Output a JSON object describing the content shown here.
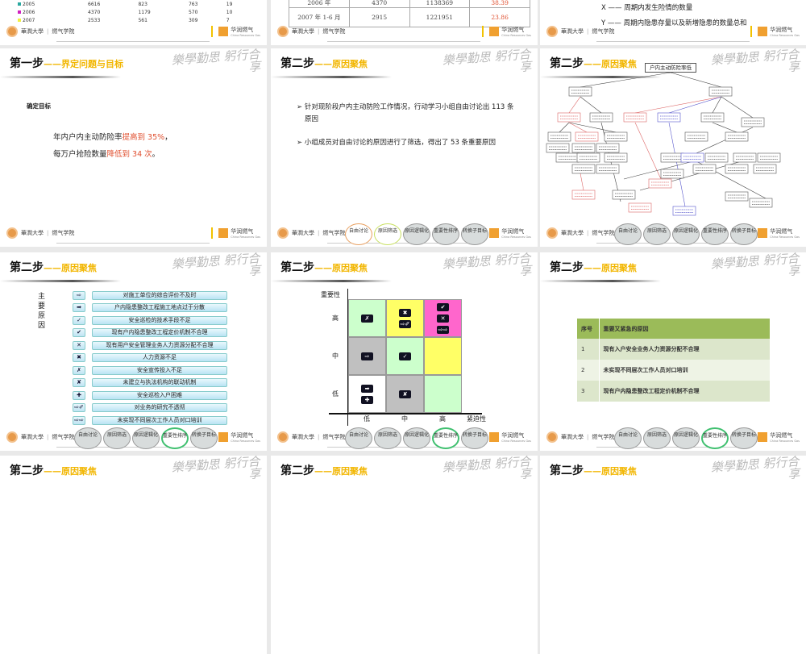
{
  "common": {
    "step1_title": "第一步",
    "step1_sub": "——界定问题与目标",
    "step2_title": "第二步",
    "step2_sub": "——原因聚焦",
    "calligraphy": "樂學勤思 躬行合享",
    "univ": "華潤大學",
    "college": "燃气学院",
    "brand": "华润燃气",
    "brand_en": "China Resources Gas",
    "steps": [
      "自由讨论",
      "原因筛选",
      "原因逻辑化",
      "重要性排序",
      "转换子目标"
    ]
  },
  "slide_a": {
    "legend": [
      {
        "year": "2005",
        "color": "#2aa8a0",
        "v": [
          "6616",
          "823",
          "763",
          "19"
        ]
      },
      {
        "year": "2006",
        "color": "#d020c0",
        "v": [
          "4370",
          "1179",
          "570",
          "10"
        ]
      },
      {
        "year": "2007",
        "color": "#f0f040",
        "v": [
          "2533",
          "561",
          "309",
          "7"
        ]
      }
    ]
  },
  "slide_b": {
    "rows": [
      [
        "2006 年",
        "4370",
        "1138369",
        "38.39"
      ],
      [
        "2007 年 1-6 月",
        "2915",
        "1221951",
        "23.86"
      ]
    ]
  },
  "slide_c": {
    "x_line": "X —— 周期内发生险情的数量",
    "y_line": "Y —— 周期内隐患存量以及新增隐患的数量总和"
  },
  "slide_goal": {
    "heading": "确定目标",
    "l1a": "年内户内主动防险率",
    "l1b": "提高到 35%",
    "l1c": "，",
    "l2a": "每万户抢险数量",
    "l2b": "降低到 34 次",
    "l2c": "。"
  },
  "slide_focus": {
    "b1": "针对现阶段户内主动防险工作情况，行动学习小组自由讨论出 113 条原因",
    "b2": "小组成员对自由讨论的原因进行了筛选，得出了 53 条重要原因",
    "bullet": "➢"
  },
  "slide_tree": {
    "root": "户内主动防险率低"
  },
  "slide_reasons": {
    "label": "主要原因",
    "items": [
      {
        "icon": "⇨",
        "text": "对施工单位的综合评价不及时"
      },
      {
        "icon": "➡",
        "text": "户内隐患整改工程施工地点过于分散"
      },
      {
        "icon": "✓",
        "text": "安全巡检的技术手段不足"
      },
      {
        "icon": "✔",
        "text": "现有户内隐患整改工程定价机制不合理"
      },
      {
        "icon": "✕",
        "text": "现有用户安全管理业务人力资源分配不合理"
      },
      {
        "icon": "✖",
        "text": "人力资源不足"
      },
      {
        "icon": "✗",
        "text": "安全宣传投入不足"
      },
      {
        "icon": "✘",
        "text": "未建立与执法机构的联动机制"
      },
      {
        "icon": "✚",
        "text": "安全巡检入户困难"
      },
      {
        "icon": "⇨✐",
        "text": "对业务的研究不透彻"
      },
      {
        "icon": "⇨⇨",
        "text": "未实现不同层次工作人员对口培训"
      }
    ]
  },
  "slide_matrix": {
    "y_label": "重要性",
    "x_label": "紧迫性",
    "levels": [
      "低",
      "中",
      "高"
    ],
    "cells": [
      {
        "imp": "高",
        "urg": "低",
        "color": "#ccffcc",
        "icons": [
          "✗"
        ]
      },
      {
        "imp": "高",
        "urg": "中",
        "color": "#ffff66",
        "icons": [
          "✖",
          "⇨✐"
        ]
      },
      {
        "imp": "高",
        "urg": "高",
        "color": "#ff66cc",
        "icons": [
          "✔",
          "✕",
          "⇨⇨"
        ]
      },
      {
        "imp": "中",
        "urg": "低",
        "color": "#c0c0c0",
        "icons": [
          "⇨"
        ]
      },
      {
        "imp": "中",
        "urg": "中",
        "color": "#ccffcc",
        "icons": [
          "✓"
        ]
      },
      {
        "imp": "中",
        "urg": "高",
        "color": "#ffff66",
        "icons": []
      },
      {
        "imp": "低",
        "urg": "低",
        "color": "#ffffff",
        "icons": [
          "➡",
          "✚"
        ]
      },
      {
        "imp": "低",
        "urg": "中",
        "color": "#c0c0c0",
        "icons": [
          "✘"
        ]
      },
      {
        "imp": "低",
        "urg": "高",
        "color": "#ccffcc",
        "icons": []
      }
    ]
  },
  "slide_table": {
    "headers": [
      "序号",
      "重要又紧急的原因"
    ],
    "rows": [
      [
        "1",
        "现有入户安全业务人力资源分配不合理"
      ],
      [
        "2",
        "未实现不同层次工作人员对口培训"
      ],
      [
        "3",
        "现有户内隐患整改工程定价机制不合理"
      ]
    ]
  }
}
